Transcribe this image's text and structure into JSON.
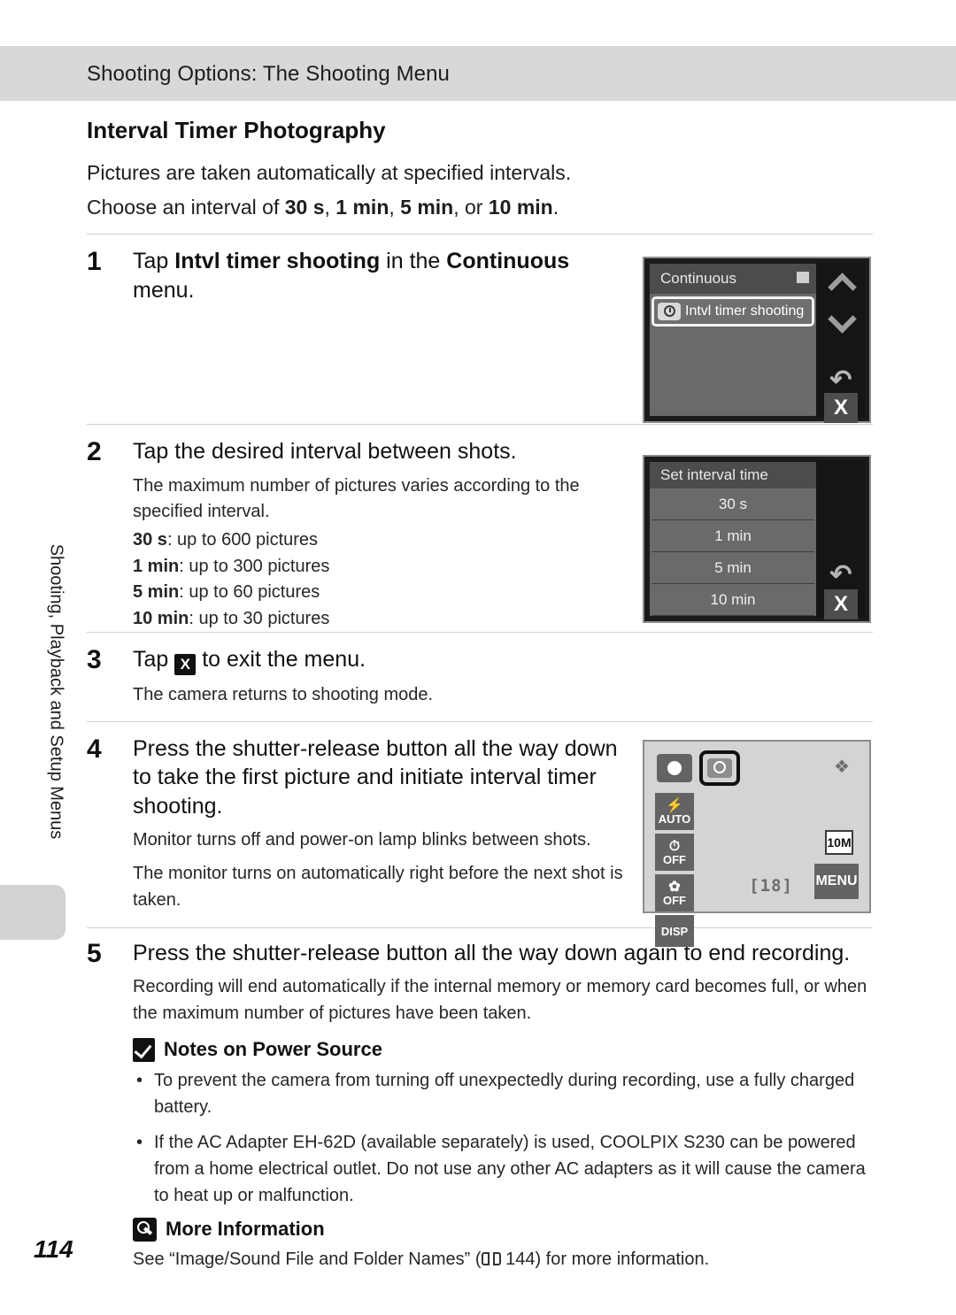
{
  "header": {
    "title": "Shooting Options: The Shooting Menu"
  },
  "side_tab": {
    "label": "Shooting, Playback and Setup Menus"
  },
  "page": {
    "number": "114"
  },
  "section": {
    "title": "Interval Timer Photography",
    "lead_1": "Pictures are taken automatically at specified intervals.",
    "lead_2_prefix": "Choose an interval of ",
    "lead_2_v1": "30 s",
    "lead_2_sep1": ", ",
    "lead_2_v2": "1 min",
    "lead_2_sep2": ", ",
    "lead_2_v3": "5 min",
    "lead_2_sep3": ", or ",
    "lead_2_v4": "10 min",
    "lead_2_suffix": "."
  },
  "steps": [
    {
      "number": "1",
      "head_pre": "Tap ",
      "head_b1": "Intvl timer shooting",
      "head_mid": " in the ",
      "head_b2": "Continuous",
      "head_post": " menu."
    },
    {
      "number": "2",
      "head": "Tap the desired interval between shots.",
      "sub_line1": "The maximum number of pictures varies according to the specified interval.",
      "intervals": [
        {
          "label": "30 s",
          "value": ": up to 600 pictures"
        },
        {
          "label": "1 min",
          "value": ": up to 300 pictures"
        },
        {
          "label": "5 min",
          "value": ": up to 60 pictures"
        },
        {
          "label": "10 min",
          "value": ": up to 30 pictures"
        }
      ]
    },
    {
      "number": "3",
      "head_pre": "Tap ",
      "head_icon": "X",
      "head_post": " to exit the menu.",
      "sub_line1": "The camera returns to shooting mode."
    },
    {
      "number": "4",
      "head": "Press the shutter-release button all the way down to take the first picture and initiate interval timer shooting.",
      "sub_line1": "Monitor turns off and power-on lamp blinks between shots.",
      "sub_line2": "The monitor turns on automatically right before the next shot is taken."
    },
    {
      "number": "5",
      "head": "Press the shutter-release button all the way down again to end recording.",
      "sub_line1": "Recording will end automatically if the internal memory or memory card becomes full, or when the maximum number of pictures have been taken."
    }
  ],
  "notes_power": {
    "title": "Notes on Power Source",
    "bullets": [
      "To prevent the camera from turning off unexpectedly during recording, use a fully charged battery.",
      "If the AC Adapter EH-62D (available separately) is used, COOLPIX S230 can be powered from a home electrical outlet. Do not use any other AC adapters as it will cause the camera to heat up or malfunction."
    ]
  },
  "more_information": {
    "title": "More Information",
    "text_pre": "See “Image/Sound File and Folder Names” (",
    "ref_page": "144",
    "text_post": ") for more information."
  },
  "screens": {
    "continuous_menu": {
      "title": "Continuous",
      "item_label": "Intvl timer shooting",
      "sidebar": {
        "up": "up-chevron",
        "down": "down-chevron",
        "back": "↶",
        "close": "X"
      }
    },
    "set_interval": {
      "title": "Set interval time",
      "options": [
        "30 s",
        "1 min",
        "5 min",
        "10 min"
      ],
      "sidebar": {
        "back": "↶",
        "close": "X"
      }
    },
    "shooting_display": {
      "flash_label": "AUTO",
      "selftimer_label": "OFF",
      "macro_label": "OFF",
      "disp_label": "DISP",
      "image_size": "10M",
      "shots_remaining": "18",
      "menu_label": "MENU"
    }
  },
  "colors": {
    "header_band": "#d8d8d8",
    "lcd_body": "#6a6a6a",
    "lcd_frame": "#1b1b1b",
    "shoot_bg": "#d4d4d4"
  }
}
